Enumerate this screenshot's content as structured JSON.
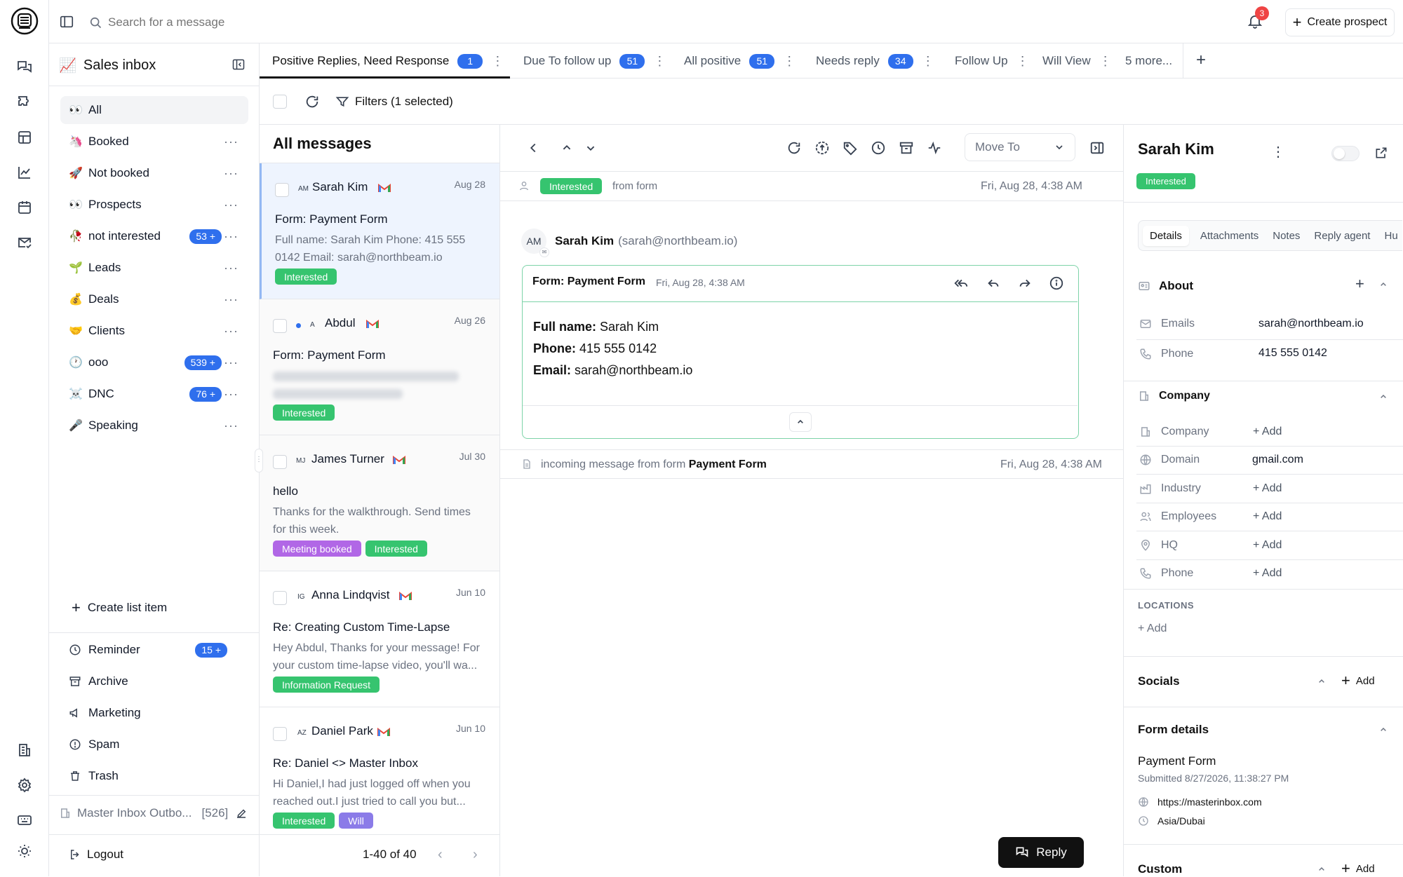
{
  "search": {
    "placeholder": "Search for a message"
  },
  "notifications": {
    "count": "3"
  },
  "header": {
    "create_prospect": "Create prospect"
  },
  "sidebar": {
    "title": "Sales inbox",
    "items": [
      {
        "emoji": "👀",
        "label": "All",
        "badge": ""
      },
      {
        "emoji": "🦄",
        "label": "Booked",
        "badge": ""
      },
      {
        "emoji": "🚀",
        "label": "Not booked",
        "badge": ""
      },
      {
        "emoji": "👀",
        "label": "Prospects",
        "badge": ""
      },
      {
        "emoji": "🥀",
        "label": "not interested",
        "badge": "53 +"
      },
      {
        "emoji": "🌱",
        "label": "Leads",
        "badge": ""
      },
      {
        "emoji": "💰",
        "label": "Deals",
        "badge": ""
      },
      {
        "emoji": "🤝",
        "label": "Clients",
        "badge": ""
      },
      {
        "emoji": "🕐",
        "label": "ooo",
        "badge": "539 +"
      },
      {
        "emoji": "☠️",
        "label": "DNC",
        "badge": "76 +"
      },
      {
        "emoji": "🎤",
        "label": "Speaking",
        "badge": ""
      }
    ],
    "create_list_item": "Create list item",
    "system": [
      {
        "label": "Reminder",
        "badge": "15 +"
      },
      {
        "label": "Archive"
      },
      {
        "label": "Marketing"
      },
      {
        "label": "Spam"
      },
      {
        "label": "Trash"
      }
    ],
    "outbox_label": "Master Inbox Outbo...",
    "outbox_count": "[526]",
    "logout": "Logout"
  },
  "tabs": [
    {
      "label": "Positive Replies, Need Response",
      "count": "1"
    },
    {
      "label": "Due To follow up",
      "count": "51"
    },
    {
      "label": "All positive",
      "count": "51"
    },
    {
      "label": "Needs reply",
      "count": "34"
    },
    {
      "label": "Follow Up",
      "count": ""
    },
    {
      "label": "Will View",
      "count": ""
    },
    {
      "label": "5 more...",
      "count": ""
    }
  ],
  "filters": {
    "label": "Filters (1 selected)"
  },
  "list": {
    "title": "All messages",
    "messages": [
      {
        "initials": "AM",
        "name": "Sarah Kim",
        "date": "Aug 28",
        "subject": "Form: Payment Form",
        "preview": "Full name: Sarah Kim Phone: 415 555 0142 Email: sarah@northbeam.io",
        "tags": [
          "Interested"
        ]
      },
      {
        "initials": "A",
        "name": "Abdul",
        "date": "Aug 26",
        "subject": "Form: Payment Form",
        "preview": "",
        "tags": [
          "Interested"
        ]
      },
      {
        "initials": "MJ",
        "name": "James Turner",
        "date": "Jul 30",
        "subject": "hello",
        "preview": "Thanks for the walkthrough. Send times for this week.",
        "tags": [
          "Meeting booked",
          "Interested"
        ]
      },
      {
        "initials": "IG",
        "name": "Anna Lindqvist",
        "date": "Jun 10",
        "subject": "Re: Creating Custom Time-Lapse",
        "preview": "Hey Abdul, Thanks for your message! For your custom time-lapse video, you'll wa...",
        "tags": [
          "Information Request"
        ]
      },
      {
        "initials": "AZ",
        "name": "Daniel Park",
        "date": "Jun 10",
        "subject": "Re: Daniel <> Master Inbox",
        "preview": "Hi Daniel,I had just logged off when you reached out.I just tried to call you but...",
        "tags": [
          "Interested",
          "Will"
        ]
      }
    ],
    "pagination": "1-40 of 40"
  },
  "reader": {
    "move_to": "Move To",
    "status_tag": "Interested",
    "status_source": "from form",
    "status_date": "Fri, Aug 28, 4:38 AM",
    "avatar": "AM",
    "sender_name": "Sarah Kim",
    "sender_email": "(sarah@northbeam.io)",
    "card_subject": "Form: Payment Form",
    "card_date": "Fri, Aug 28, 4:38 AM",
    "body": {
      "name_label": "Full name:",
      "name_value": "Sarah Kim",
      "phone_label": "Phone:",
      "phone_value": "415 555 0142",
      "email_label": "Email:",
      "email_value": "sarah@northbeam.io"
    },
    "log_text": "incoming message from form",
    "log_form": "Payment Form",
    "log_date": "Fri, Aug 28, 4:38 AM",
    "reply": "Reply"
  },
  "contact": {
    "name": "Sarah Kim",
    "status": "Interested",
    "tabs": [
      "Details",
      "Attachments",
      "Notes",
      "Reply agent",
      "Hu"
    ],
    "about": {
      "title": "About",
      "emails_label": "Emails",
      "emails_value": "sarah@northbeam.io",
      "phone_label": "Phone",
      "phone_value": "415 555 0142"
    },
    "company": {
      "title": "Company",
      "company_label": "Company",
      "company_value": "Add",
      "domain_label": "Domain",
      "domain_value": "gmail.com",
      "industry_label": "Industry",
      "industry_value": "Add",
      "employees_label": "Employees",
      "employees_value": "Add",
      "hq_label": "HQ",
      "hq_value": "Add",
      "phone_label": "Phone",
      "phone_value": "Add",
      "locations_label": "LOCATIONS",
      "locations_add": "Add"
    },
    "socials": {
      "title": "Socials",
      "add": "Add"
    },
    "form_details": {
      "title": "Form details",
      "form_name": "Payment Form",
      "submitted": "Submitted 8/27/2026, 11:38:27 PM",
      "url": "https://masterinbox.com",
      "timezone": "Asia/Dubai"
    },
    "custom": {
      "title": "Custom",
      "add": "Add"
    }
  },
  "colors": {
    "accent": "#2f6fed",
    "green": "#36c46f",
    "purple": "#b167e6",
    "violet": "#8b7be8"
  }
}
